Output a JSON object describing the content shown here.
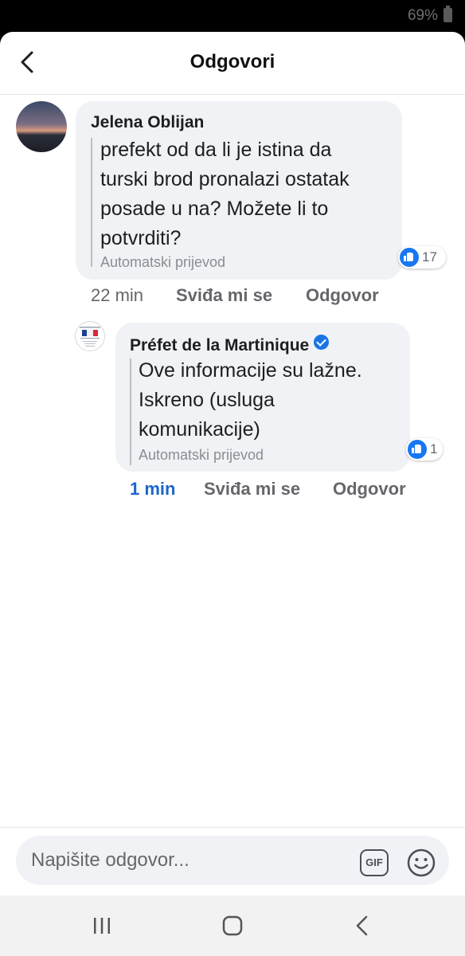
{
  "status_bar": {
    "battery": "69%"
  },
  "header": {
    "title": "Odgovori"
  },
  "comment": {
    "author": "Jelena Oblijan",
    "text": "prefekt od da li je istina da\nturski brod pronalazi ostatak\nposade u na? Možete li to\npotvrditi?",
    "translation_label": "Automatski prijevod",
    "reaction_count": "17",
    "time": "22 min",
    "like_label": "Sviđa mi se",
    "reply_label": "Odgovor"
  },
  "reply": {
    "author": "Préfet de la Martinique",
    "verified": true,
    "text": "Ove informacije su lažne.\nIskreno (usluga\nkomunikacije)",
    "translation_label": "Automatski prijevod",
    "reaction_count": "1",
    "time": "1 min",
    "like_label": "Sviđa mi se",
    "reply_label": "Odgovor"
  },
  "composer": {
    "placeholder": "Napišite odgovor...",
    "gif_label": "GIF"
  },
  "colors": {
    "accent": "#1877f2",
    "bubble": "#f0f2f5",
    "meta_text": "#65676b",
    "time_highlight": "#1b66c9"
  },
  "icons": {
    "back": "chevron-left-icon",
    "verified": "verified-badge-icon",
    "like": "like-icon",
    "gif": "gif-icon",
    "emoji": "emoji-icon",
    "nav": [
      "recent-apps-icon",
      "home-icon",
      "back-icon"
    ]
  }
}
